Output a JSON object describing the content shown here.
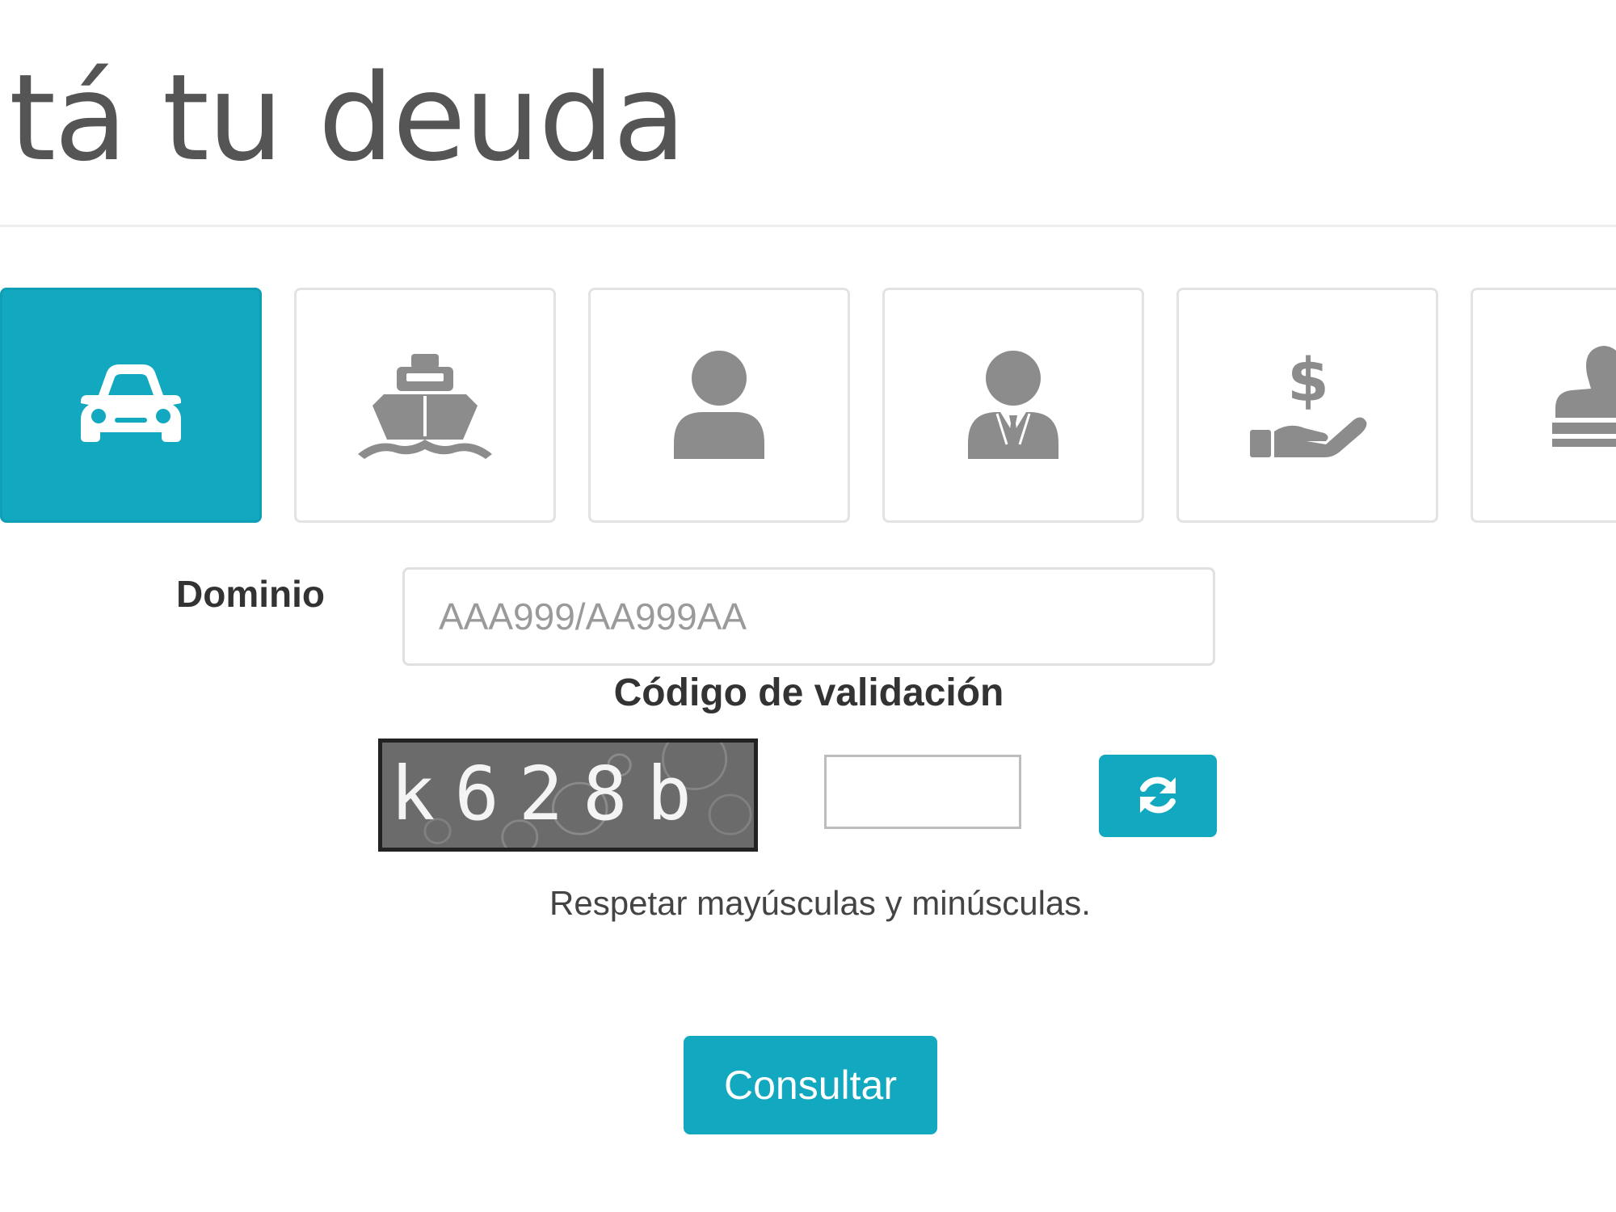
{
  "page": {
    "title": "ltá tu deuda"
  },
  "tabs": [
    {
      "icon": "car-icon",
      "active": true
    },
    {
      "icon": "ship-icon",
      "active": false
    },
    {
      "icon": "person-icon",
      "active": false
    },
    {
      "icon": "businessman-icon",
      "active": false
    },
    {
      "icon": "hand-money-icon",
      "active": false
    },
    {
      "icon": "stamp-icon",
      "active": false
    }
  ],
  "form": {
    "dominio_label": "Dominio",
    "dominio_placeholder": "AAA999/AA999AA",
    "codigo_label": "Código de validación",
    "captcha_text": "k628b",
    "captcha_value": "",
    "refresh_icon": "refresh-icon",
    "hint": "Respetar mayúsculas y minúsculas.",
    "submit_label": "Consultar"
  },
  "colors": {
    "accent": "#12a8bf",
    "icon_gray": "#8c8c8c",
    "title_text": "#555555",
    "captcha_bg": "#6b6b6b"
  }
}
